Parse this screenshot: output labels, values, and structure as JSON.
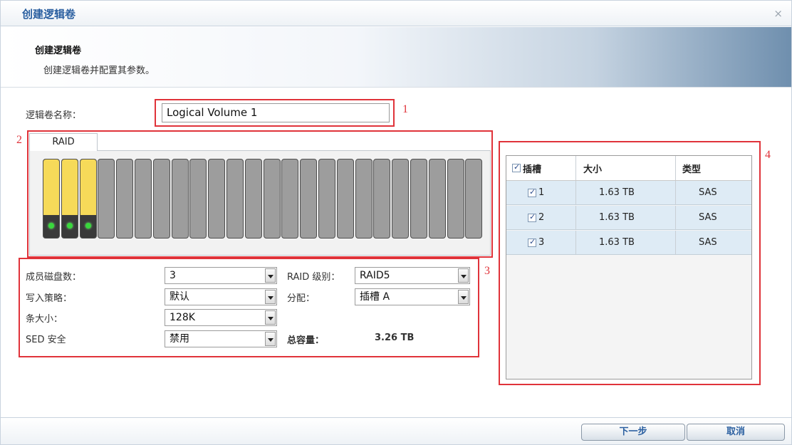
{
  "window": {
    "title": "创建逻辑卷",
    "close_glyph": "×"
  },
  "banner": {
    "heading": "创建逻辑卷",
    "subtitle": "创建逻辑卷并配置其参数。"
  },
  "name_field": {
    "label": "逻辑卷名称：",
    "value": "Logical Volume 1"
  },
  "raid_panel": {
    "tab_label": "RAID",
    "total_slots": 24,
    "active_slots": 3
  },
  "config": {
    "member_disks_label": "成员磁盘数：",
    "member_disks_value": "3",
    "write_policy_label": "写入策略：",
    "write_policy_value": "默认",
    "stripe_size_label": "条大小：",
    "stripe_size_value": "128K",
    "sed_label": "SED 安全",
    "sed_value": "禁用",
    "raid_level_label": "RAID 级别：",
    "raid_level_value": "RAID5",
    "allocation_label": "分配：",
    "allocation_value": "插槽 A",
    "total_capacity_label": "总容量：",
    "total_capacity_value": "3.26 TB"
  },
  "slot_table": {
    "headers": {
      "slot": "插槽",
      "size": "大小",
      "type": "类型"
    },
    "rows": [
      {
        "slot": "1",
        "size": "1.63 TB",
        "type": "SAS"
      },
      {
        "slot": "2",
        "size": "1.63 TB",
        "type": "SAS"
      },
      {
        "slot": "3",
        "size": "1.63 TB",
        "type": "SAS"
      }
    ]
  },
  "annotations": {
    "n1": "1",
    "n2": "2",
    "n3": "3",
    "n4": "4"
  },
  "footer": {
    "next_label": "下一步",
    "cancel_label": "取消"
  },
  "colors": {
    "accent": "#2a5fa0",
    "annotation_red": "#e0333a",
    "disk_active": "#f6da59",
    "led_green": "#39d83c"
  }
}
